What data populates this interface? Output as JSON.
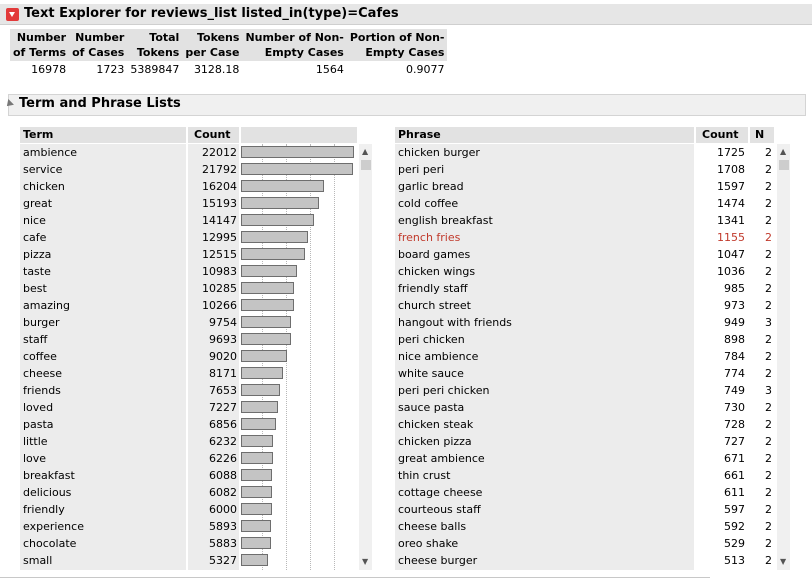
{
  "header": {
    "title": "Text Explorer for reviews_list listed_in(type)=Cafes"
  },
  "stats": {
    "columns": [
      [
        "Number",
        "of Terms"
      ],
      [
        "Number",
        "of Cases"
      ],
      [
        "Total",
        "Tokens"
      ],
      [
        "Tokens",
        "per Case"
      ],
      [
        "Number of Non-",
        "Empty Cases"
      ],
      [
        "Portion of Non-",
        "Empty Cases"
      ]
    ],
    "values": [
      "16978",
      "1723",
      "5389847",
      "3128.18",
      "1564",
      "0.9077"
    ]
  },
  "section": {
    "title": "Term and Phrase Lists"
  },
  "terms": {
    "headers": {
      "term": "Term",
      "count": "Count"
    },
    "max": 22012,
    "rows": [
      {
        "term": "ambience",
        "count": "22012",
        "value": 22012
      },
      {
        "term": "service",
        "count": "21792",
        "value": 21792
      },
      {
        "term": "chicken",
        "count": "16204",
        "value": 16204
      },
      {
        "term": "great",
        "count": "15193",
        "value": 15193
      },
      {
        "term": "nice",
        "count": "14147",
        "value": 14147
      },
      {
        "term": "cafe",
        "count": "12995",
        "value": 12995
      },
      {
        "term": "pizza",
        "count": "12515",
        "value": 12515
      },
      {
        "term": "taste",
        "count": "10983",
        "value": 10983
      },
      {
        "term": "best",
        "count": "10285",
        "value": 10285
      },
      {
        "term": "amazing",
        "count": "10266",
        "value": 10266
      },
      {
        "term": "burger",
        "count": "9754",
        "value": 9754
      },
      {
        "term": "staff",
        "count": "9693",
        "value": 9693
      },
      {
        "term": "coffee",
        "count": "9020",
        "value": 9020
      },
      {
        "term": "cheese",
        "count": "8171",
        "value": 8171
      },
      {
        "term": "friends",
        "count": "7653",
        "value": 7653
      },
      {
        "term": "loved",
        "count": "7227",
        "value": 7227
      },
      {
        "term": "pasta",
        "count": "6856",
        "value": 6856
      },
      {
        "term": "little",
        "count": "6232",
        "value": 6232
      },
      {
        "term": "love",
        "count": "6226",
        "value": 6226
      },
      {
        "term": "breakfast",
        "count": "6088",
        "value": 6088
      },
      {
        "term": "delicious",
        "count": "6082",
        "value": 6082
      },
      {
        "term": "friendly",
        "count": "6000",
        "value": 6000
      },
      {
        "term": "experience",
        "count": "5893",
        "value": 5893
      },
      {
        "term": "chocolate",
        "count": "5883",
        "value": 5883
      },
      {
        "term": "small",
        "count": "5327",
        "value": 5327
      }
    ]
  },
  "phrases": {
    "headers": {
      "phrase": "Phrase",
      "count": "Count",
      "n": "N"
    },
    "highlight_color": "#c0392b",
    "rows": [
      {
        "phrase": "chicken burger",
        "count": "1725",
        "n": "2"
      },
      {
        "phrase": "peri peri",
        "count": "1708",
        "n": "2"
      },
      {
        "phrase": "garlic bread",
        "count": "1597",
        "n": "2"
      },
      {
        "phrase": "cold coffee",
        "count": "1474",
        "n": "2"
      },
      {
        "phrase": "english breakfast",
        "count": "1341",
        "n": "2"
      },
      {
        "phrase": "french fries",
        "count": "1155",
        "n": "2",
        "highlight": true
      },
      {
        "phrase": "board games",
        "count": "1047",
        "n": "2"
      },
      {
        "phrase": "chicken wings",
        "count": "1036",
        "n": "2"
      },
      {
        "phrase": "friendly staff",
        "count": "985",
        "n": "2"
      },
      {
        "phrase": "church street",
        "count": "973",
        "n": "2"
      },
      {
        "phrase": "hangout with friends",
        "count": "949",
        "n": "3"
      },
      {
        "phrase": "peri chicken",
        "count": "898",
        "n": "2"
      },
      {
        "phrase": "nice ambience",
        "count": "784",
        "n": "2"
      },
      {
        "phrase": "white sauce",
        "count": "774",
        "n": "2"
      },
      {
        "phrase": "peri peri chicken",
        "count": "749",
        "n": "3"
      },
      {
        "phrase": "sauce pasta",
        "count": "730",
        "n": "2"
      },
      {
        "phrase": "chicken steak",
        "count": "728",
        "n": "2"
      },
      {
        "phrase": "chicken pizza",
        "count": "727",
        "n": "2"
      },
      {
        "phrase": "great ambience",
        "count": "671",
        "n": "2"
      },
      {
        "phrase": "thin crust",
        "count": "661",
        "n": "2"
      },
      {
        "phrase": "cottage cheese",
        "count": "611",
        "n": "2"
      },
      {
        "phrase": "courteous staff",
        "count": "597",
        "n": "2"
      },
      {
        "phrase": "cheese balls",
        "count": "592",
        "n": "2"
      },
      {
        "phrase": "oreo shake",
        "count": "529",
        "n": "2"
      },
      {
        "phrase": "cheese burger",
        "count": "513",
        "n": "2"
      }
    ]
  }
}
